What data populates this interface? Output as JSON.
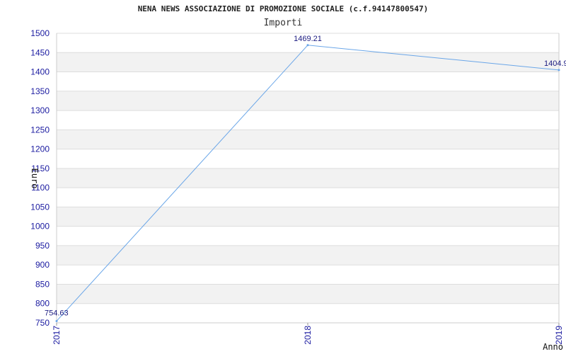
{
  "chart_data": {
    "type": "line",
    "title": "NENA NEWS ASSOCIAZIONE DI PROMOZIONE SOCIALE (c.f.94147800547)",
    "subtitle": "Importi",
    "xlabel": "Anno",
    "ylabel": "Euro",
    "categories": [
      "2017",
      "2018",
      "2019"
    ],
    "series": [
      {
        "values": [
          754.63,
          1469.21,
          1404.9
        ]
      }
    ],
    "data_labels": [
      "754.63",
      "1469.21",
      "1404.9"
    ],
    "ylim": [
      750,
      1500
    ],
    "y_ticks": [
      750,
      800,
      850,
      900,
      950,
      1000,
      1050,
      1100,
      1150,
      1200,
      1250,
      1300,
      1350,
      1400,
      1450,
      1500
    ],
    "grid": true,
    "line_color": "#6aa6e8",
    "band_color": "#f2f2f2",
    "tick_color": "#1a1aa0"
  }
}
